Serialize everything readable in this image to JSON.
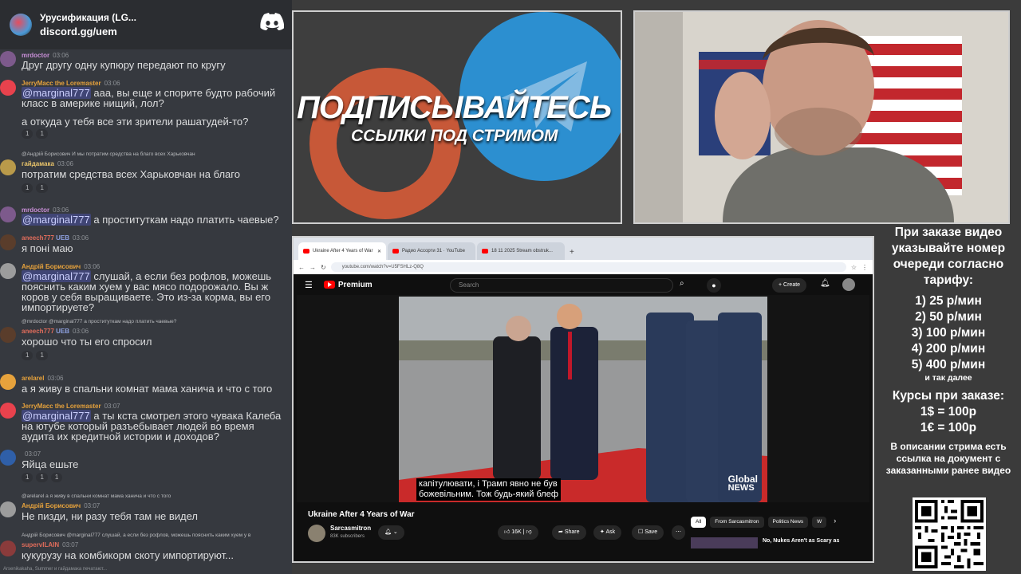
{
  "chat": {
    "server_name": "Урусификация (LG...",
    "server_link": "discord.gg/uem",
    "messages": [
      {
        "user": "mrdoctor",
        "user_color": "#c98fd8",
        "time": "03:06",
        "text": "Друг другу одну купюру передают по кругу"
      },
      {
        "user": "JerryMacc the Loremaster",
        "user_color": "#e6a23c",
        "time": "03:06",
        "mention": "@marginal777",
        "text": "ааа, вы еще и спорите будто рабочий класс в америке нищий, лол?",
        "text2": "а откуда у тебя все эти зрители рашатудей-то?",
        "reactions": [
          "1",
          "1"
        ]
      },
      {
        "reply": "@Андрій Борисович И мы потратим средства на благо всех Харьковчан",
        "user": "гайдамака",
        "user_color": "#e9c46a",
        "time": "03:06",
        "text": "потратим средства всех Харьковчан на благо",
        "reactions": [
          "1",
          "1"
        ]
      },
      {
        "user": "mrdoctor",
        "user_color": "#c98fd8",
        "time": "03:06",
        "mention": "@marginal777",
        "text": "а проституткам надо платить чаевые?"
      },
      {
        "user": "aneech777",
        "user_color": "#e06c5b",
        "time": "03:06",
        "badge": "UEB",
        "text": "я поні маю"
      },
      {
        "user": "Андрій Борисович",
        "user_color": "#e6a23c",
        "time": "03:06",
        "mention": "@marginal777",
        "text": "слушай, а если без рофлов, можешь пояснить каким хуем у вас мясо подорожало. Вы ж коров у себя выращиваете. Это из-за корма, вы его импортируете?"
      },
      {
        "reply": "@mrdoctor @marginal777 а проституткам надо платить чаевые?",
        "user": "aneech777",
        "user_color": "#e06c5b",
        "time": "03:06",
        "badge": "UEB",
        "text": "хорошо что ты его спросил",
        "reactions": [
          "1",
          "1"
        ]
      },
      {
        "user": "arelarel",
        "user_color": "#e6a23c",
        "time": "03:06",
        "text": "а я живу в спальни комнат мама ханича и что с того"
      },
      {
        "user": "JerryMacc the Loremaster",
        "user_color": "#e6a23c",
        "time": "03:07",
        "mention": "@marginal777",
        "text": "а ты кста смотрел этого чувака Калеба на ютубе который разъебывает людей во время аудита их кредитной истории и доходов?"
      },
      {
        "user": "",
        "user_color": "#8e9297",
        "time": "03:07",
        "text": "Яйца ешьте",
        "reactions": [
          "1",
          "1",
          "1"
        ]
      },
      {
        "reply": "@arelarel а я живу в спальни комнат мама ханича и что с того",
        "user": "Андрій Борисович",
        "user_color": "#e6a23c",
        "time": "03:07",
        "text": "Не пизди, ни разу тебя там не видел"
      },
      {
        "reply": "Андрій Борисович @marginal777 слушай, а если без рофлов, можешь пояснить каким хуем у в",
        "user": "supervILAIN",
        "user_color": "#e06c5b",
        "time": "03:07",
        "text": "кукурузу на комбикорм скоту импортируют..."
      }
    ],
    "typing": "Arsenikakaha, Summer и гайдамака печатают..."
  },
  "promo": {
    "title": "ПОДПИСЫВАЙТЕСЬ",
    "subtitle": "ССЫЛКИ ПОД СТРИМОМ"
  },
  "browser": {
    "tabs": [
      {
        "label": "Ukraine After 4 Years of War",
        "active": true
      },
      {
        "label": "Радио Ассорти 31 · YouTube",
        "active": false
      },
      {
        "label": "18 11 2025 Stream obstruk...",
        "active": false
      }
    ],
    "url": "youtube.com/watch?v=U5FSHLz-Q8Q",
    "yt": {
      "logo_label": "Premium",
      "search_placeholder": "Search",
      "create_label": "Create",
      "subtitle_line1": "капітулювати, і Трамп явно не був",
      "subtitle_line2": "божевільним.  Тож будь-який блеф",
      "watermark_top": "Global",
      "watermark_bottom": "NEWS",
      "video_title": "Ukraine After 4 Years of War",
      "channel_name": "Sarcasmitron",
      "subscribers": "83K subscribers",
      "likes": "16K",
      "share_label": "Share",
      "ask_label": "Ask",
      "save_label": "Save",
      "chips": [
        "All",
        "From Sarcasmitron",
        "Politics News",
        "W"
      ],
      "related_title": "No, Nukes Aren't as Scary as"
    }
  },
  "info": {
    "heading": "При заказе видео указывайте номер очереди согласно тарифу:",
    "tariffs": [
      "1) 25 р/мин",
      "2) 50 р/мин",
      "3) 100 р/мин",
      "4) 200 р/мин",
      "5) 400 р/мин"
    ],
    "etc": "и так далее",
    "rates_heading": "Курсы при заказе:",
    "rates": [
      "1$ = 100р",
      "1€ = 100р"
    ],
    "note": "В описании стрима есть ссылка на документ с заказанными ранее видео"
  },
  "colors": {
    "discord_bg": "#36393f",
    "mention_bg": "#5865f2",
    "yt_red": "#ff0000",
    "telegram_blue": "#2c8fd0",
    "patreon_orange": "#c75838"
  }
}
